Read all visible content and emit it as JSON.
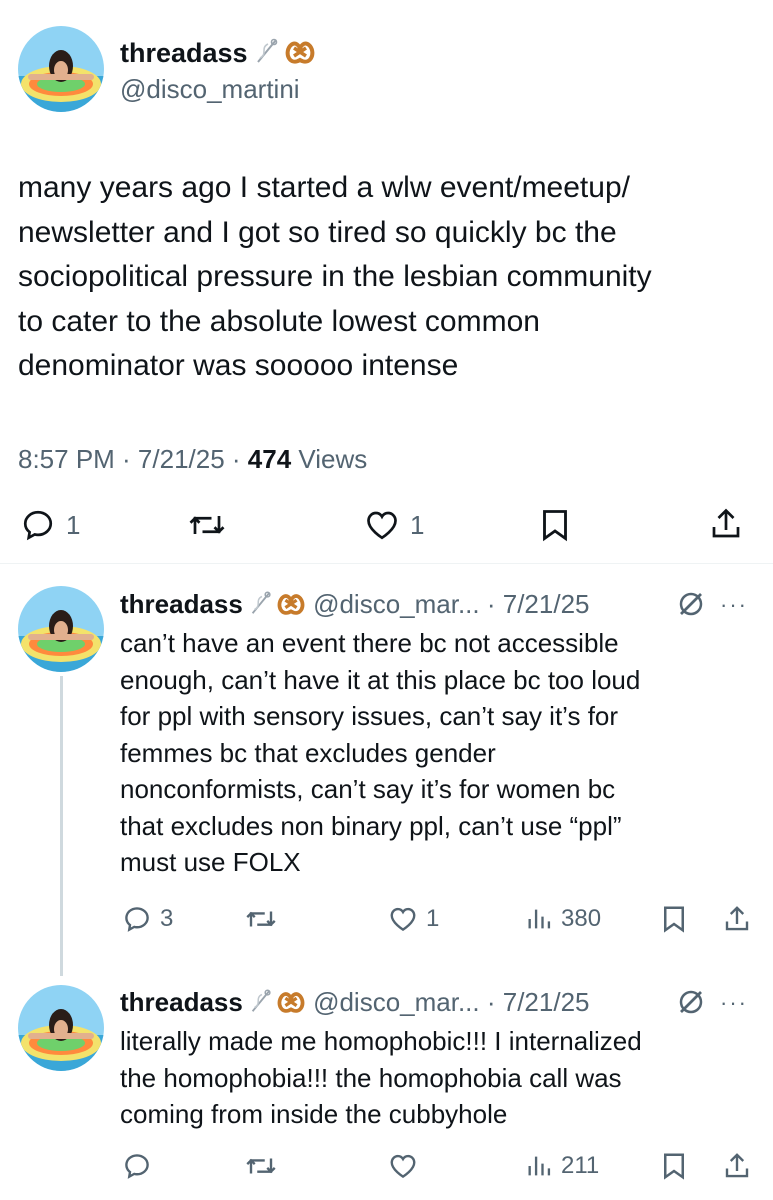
{
  "main_tweet": {
    "display_name": "threadass",
    "handle": "@disco_martini",
    "text": "many years ago I started a wlw event/meetup/\nnewsletter and I got so tired so quickly bc the\nsociopolitical pressure in the lesbian community\nto cater to the absolute lowest common\ndenominator was sooooo intense",
    "time": "8:57 PM · 7/21/25 · ",
    "views_count": "474",
    "views_label": " Views",
    "actions": {
      "reply_count": "1",
      "retweet_count": "",
      "like_count": "1"
    }
  },
  "replies": [
    {
      "display_name": "threadass",
      "handle_date": " @disco_mar... · 7/21/25",
      "text": "can’t have an event there bc not accessible\nenough, can’t have it at this place bc too loud\nfor ppl with sensory issues, can’t say it’s for\nfemmes bc that excludes gender\nnonconformists, can’t say it’s for women bc\nthat excludes non binary ppl, can’t use “ppl”\nmust use FOLX",
      "reply_count": "3",
      "like_count": "1",
      "views": "380",
      "more": "···"
    },
    {
      "display_name": "threadass",
      "handle_date": " @disco_mar... · 7/21/25",
      "text": "literally made me homophobic!!! I internalized\nthe homophobia!!! the homophobia call was\ncoming from inside the cubbyhole",
      "reply_count": "",
      "like_count": "",
      "views": "211",
      "more": "···"
    }
  ],
  "icons": [
    "thread-emoji-icon",
    "pretzel-emoji-icon",
    "reply-icon",
    "retweet-icon",
    "like-icon",
    "bookmark-icon",
    "share-icon",
    "views-icon",
    "grok-icon",
    "more-icon"
  ],
  "colors": {
    "text": "#0f1419",
    "secondary": "#536471",
    "divider": "#eff3f4",
    "thread_line": "#cfd9de"
  }
}
